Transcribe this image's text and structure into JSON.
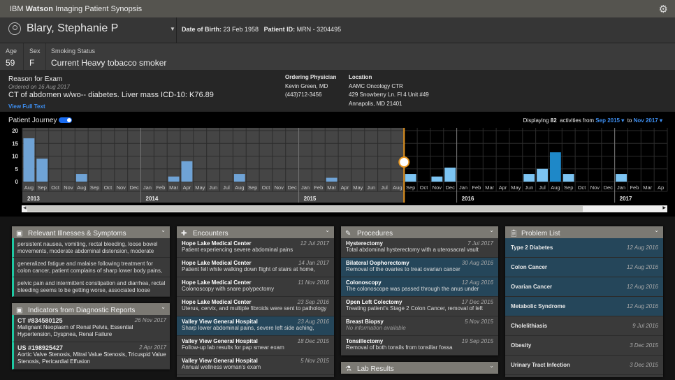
{
  "app": {
    "title_prefix": "IBM",
    "title_brand": "Watson",
    "title_rest": "Imaging Patient Synopsis"
  },
  "patient": {
    "name": "Blary, Stephanie P",
    "dob_label": "Date of Birth:",
    "dob": "23 Feb 1958",
    "id_label": "Patient ID:",
    "id": "MRN - 3204495",
    "age_label": "Age",
    "age": "59",
    "sex_label": "Sex",
    "sex": "F",
    "smoking_label": "Smoking Status",
    "smoking": "Current Heavy tobacco smoker"
  },
  "exam": {
    "label": "Reason for Exam",
    "ordered": "Ordered on 16 Aug 2017",
    "text": "CT of abdomen w/wo-- diabetes. Liver mass ICD-10: K76.89",
    "link": "View Full Text",
    "physician_label": "Ordering Physician",
    "physician": "Kevin Green, MD",
    "phone": "(443)712-3456",
    "location_label": "Location",
    "loc1": "AAMC Oncology CTR",
    "loc2": "429 Snowberry Ln. Fl 4 Unit #49",
    "loc3": "Annapolis, MD 21401"
  },
  "journey": {
    "label": "Patient Journey",
    "toggle_on": true,
    "displaying": "Displaying",
    "count": "82",
    "activities_from": "activities from",
    "from": "Sep 2015",
    "to_label": "to",
    "to": "Nov 2017"
  },
  "chart_data": {
    "type": "bar",
    "ylim": [
      0,
      20
    ],
    "yticks": [
      "20",
      "15",
      "10",
      "5",
      "0"
    ],
    "categories": [
      "Aug",
      "Sep",
      "Oct",
      "Nov",
      "Aug",
      "Sep",
      "Oct",
      "Nov",
      "Dec",
      "Jan",
      "Feb",
      "Mar",
      "Apr",
      "May",
      "Jun",
      "Jul",
      "Aug",
      "Sep",
      "Oct",
      "Nov",
      "Dec",
      "Jan",
      "Feb",
      "Mar",
      "Apr",
      "May",
      "Jun",
      "Jul",
      "Aug",
      "Sep",
      "Oct",
      "Nov",
      "Dec",
      "Jan",
      "Feb",
      "Mar",
      "Apr",
      "May",
      "Jun",
      "Jul",
      "Aug",
      "Sep",
      "Oct",
      "Nov",
      "Dec",
      "Jan",
      "Feb",
      "Mar",
      "Ap"
    ],
    "values": [
      17,
      9,
      0,
      0,
      3,
      0,
      0,
      0,
      0,
      0,
      0,
      2,
      8,
      0,
      0,
      0,
      3,
      0,
      0,
      0,
      0,
      0,
      0,
      1.5,
      0,
      0,
      0,
      0,
      0,
      3,
      0,
      2,
      5.5,
      0,
      0,
      0,
      0,
      0,
      3,
      5,
      11.5,
      3,
      0,
      0,
      0,
      3,
      0,
      0,
      0
    ],
    "years": [
      {
        "label": "2013",
        "start": 0
      },
      {
        "label": "2014",
        "start": 9
      },
      {
        "label": "2015",
        "start": 21
      },
      {
        "label": "2016",
        "start": 33
      },
      {
        "label": "2017",
        "start": 45
      }
    ],
    "selected_index": 40,
    "range_start_index": 29,
    "colors": {
      "bar_before": "#6fa3d6",
      "bar_after": "#7cc4f2",
      "bar_selected": "#1e88c8",
      "range": "#e8961e"
    }
  },
  "illnesses": {
    "title": "Relevant Illnesses & Symptoms",
    "items": [
      "persistent nausea, vomiting, rectal bleeding, loose bowel movements, moderate abdominal distension, moderate",
      "generalized fatigue and malaise following treatment for colon cancer, patient complains of sharp lower body pains,",
      "pelvic pain and intermittent constipation and diarrhea, rectal bleeding seems to be getting worse, associated loose"
    ]
  },
  "indicators": {
    "title": "Indicators from Diagnostic Reports",
    "items": [
      {
        "title": "CT #834580125",
        "date": "26 Nov 2017",
        "text": "Malignant Neoplasm of Renal Pelvis, Essential Hypertension, Dyspnea, Renal Failure"
      },
      {
        "title": "US #198925427",
        "date": "2 Apr 2017",
        "text": "Aortic Valve Stenosis, Mitral Value Stenosis, Tricuspid Value Stenosis, Pericardial Effusion"
      }
    ]
  },
  "encounters": {
    "title": "Encounters",
    "items": [
      {
        "title": "Hope Lake Medical Center",
        "date": "12 Jul 2017",
        "text": "Patient experiencing severe abdominal pains"
      },
      {
        "title": "Hope Lake Medical Center",
        "date": "14 Jan 2017",
        "text": "Patient fell while walking down flight of stairs at home,"
      },
      {
        "title": "Hope Lake Medical Center",
        "date": "11 Nov 2016",
        "text": "Colonoscopy with snare polypectomy"
      },
      {
        "title": "Hope Lake Medical Center",
        "date": "23 Sep 2016",
        "text": "Uterus, cervix, and multiple fibroids were sent to pathology"
      },
      {
        "title": "Valley View General Hospital",
        "date": "23 Aug 2016",
        "text": "Sharp lower abdominal pains, severe left side aching,"
      },
      {
        "title": "Valley View General Hospital",
        "date": "18 Dec 2015",
        "text": "Follow-up lab results for pap smear exam"
      },
      {
        "title": "Valley View General Hospital",
        "date": "5 Nov 2015",
        "text": "Annual wellness woman's exam"
      }
    ]
  },
  "procedures": {
    "title": "Procedures",
    "items": [
      {
        "title": "Hysterectomy",
        "date": "7 Jul 2017",
        "text": "Total abdominal hysterectomy with a uterosacral vault"
      },
      {
        "title": "Bilateral Oophorectomy",
        "date": "30 Aug 2016",
        "text": "Removal of the ovaries to treat ovarian cancer"
      },
      {
        "title": "Colonoscopy",
        "date": "12 Aug 2016",
        "text": "The colonoscope was passed through the anus under"
      },
      {
        "title": "Open Left Colectomy",
        "date": "17 Dec 2015",
        "text": "Treating patient's Stage 2 Colon Cancer, removal of left"
      },
      {
        "title": "Breast Biopsy",
        "date": "5 Nov 2015",
        "text": "No information available"
      },
      {
        "title": "Tonsillectomy",
        "date": "19 Sep 2015",
        "text": "Removal of both tonsils from tonsillar fossa"
      }
    ]
  },
  "lab_results": {
    "title": "Lab Results"
  },
  "problems": {
    "title": "Problem List",
    "items": [
      {
        "title": "Type 2 Diabetes",
        "date": "12 Aug 2016"
      },
      {
        "title": "Colon Cancer",
        "date": "12 Aug 2016"
      },
      {
        "title": "Ovarian Cancer",
        "date": "12 Aug 2016"
      },
      {
        "title": "Metabolic Syndrome",
        "date": "12 Aug 2016"
      },
      {
        "title": "Cholelithiasis",
        "date": "9 Jul 2016"
      },
      {
        "title": "Obesity",
        "date": "3 Dec 2015"
      },
      {
        "title": "Urinary Tract Infection",
        "date": "3 Dec 2015"
      }
    ]
  }
}
